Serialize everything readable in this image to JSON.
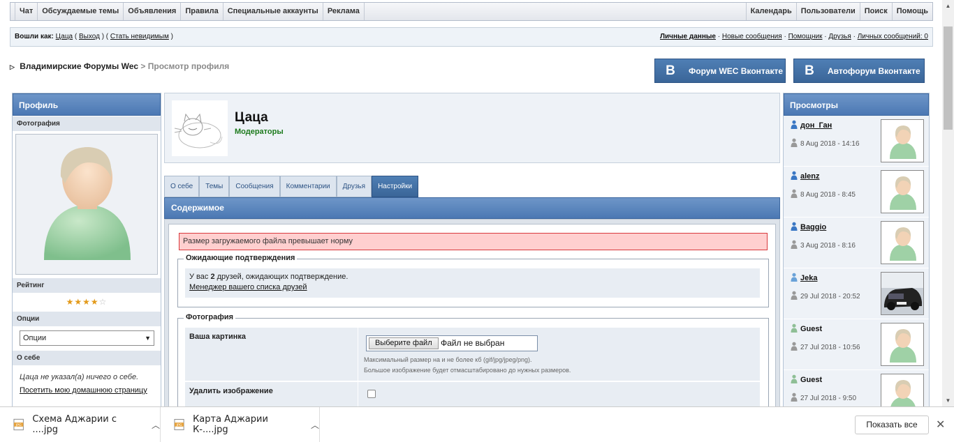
{
  "topnav": {
    "left": [
      "Чат",
      "Обсуждаемые темы",
      "Объявления",
      "Правила",
      "Специальные аккаунты",
      "Реклама"
    ],
    "right": [
      "Календарь",
      "Пользователи",
      "Поиск",
      "Помощь"
    ]
  },
  "userbar": {
    "logged_in_label": "Вошли как:",
    "username": "Цаца",
    "logout": "Выход",
    "invisible": "Стать невидимым",
    "personal_data": "Личные данные",
    "new_messages": "Новые сообщения",
    "helper": "Помощник",
    "friends": "Друзья",
    "private_messages": "Личных сообщений: 0"
  },
  "breadcrumb": {
    "forum": "Владимирские Форумы Wec",
    "separator": ">",
    "current": "Просмотр профиля"
  },
  "vk_buttons": {
    "logo": "B",
    "forum": "Форум WEC Вконтакте",
    "auto": "Автофорум Вконтакте"
  },
  "left_sidebar": {
    "title": "Профиль",
    "photo_label": "Фотография",
    "rating_label": "Рейтинг",
    "rating_stars": 4,
    "rating_max": 5,
    "options_label": "Опции",
    "options_value": "Опции",
    "about_label": "О себе",
    "about_text": "Цаца не указал(а) ничего о себе.",
    "homepage_link": "Посетить мою домашнюю страницу"
  },
  "profile": {
    "name": "Цаца",
    "group": "Модераторы"
  },
  "tabs": [
    "О себе",
    "Темы",
    "Сообщения",
    "Комментарии",
    "Друзья",
    "Настройки"
  ],
  "active_tab": 5,
  "content": {
    "title": "Содержимое",
    "error": "Размер загружаемого файла превышает норму",
    "pending_legend": "Ожидающие подтверждения",
    "pending_prefix": "У вас ",
    "pending_count": "2",
    "pending_suffix": " друзей, ожидающих подтверждение.",
    "friends_manager": "Менеджер вашего списка друзей",
    "photo_legend": "Фотография",
    "your_picture": "Ваша картинка",
    "choose_file": "Выберите файл",
    "no_file": "Файл не выбран",
    "hint1": "Максимальный размер на и не более кб (gif/jpg/jpeg/png).",
    "hint2": "Большое изображение будет отмасштабировано до нужных размеров.",
    "delete_image": "Удалить изображение"
  },
  "right_sidebar": {
    "title": "Просмотры",
    "visitors": [
      {
        "name": "дон_Ган",
        "date": "8 Aug 2018 - 14:16",
        "kind": "member",
        "photo": "default"
      },
      {
        "name": "alenz",
        "date": "8 Aug 2018 - 8:45",
        "kind": "member",
        "photo": "default"
      },
      {
        "name": "Baggio",
        "date": "3 Aug 2018 - 8:16",
        "kind": "member",
        "photo": "default"
      },
      {
        "name": "Jeka",
        "date": "29 Jul 2018 - 20:52",
        "kind": "member-light",
        "photo": "car"
      },
      {
        "name": "Guest",
        "date": "27 Jul 2018 - 10:56",
        "kind": "guest",
        "photo": "default"
      },
      {
        "name": "Guest",
        "date": "27 Jul 2018 - 9:50",
        "kind": "guest",
        "photo": "default"
      }
    ]
  },
  "downloads": {
    "file1": "Схема Аджарии с ....jpg",
    "file2": "Карта Аджарии К-....jpg",
    "show_all": "Показать все",
    "close": "✕"
  }
}
